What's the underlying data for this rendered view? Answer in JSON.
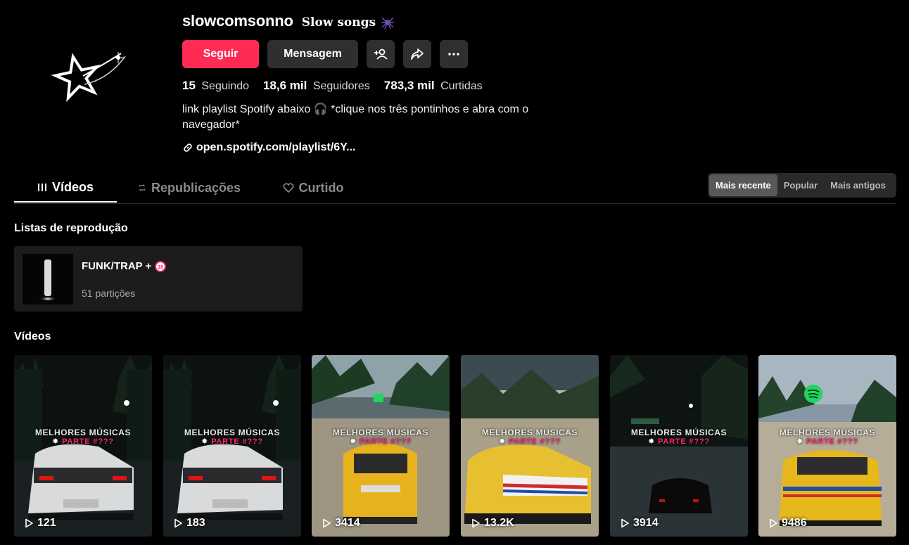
{
  "profile": {
    "username": "slowcomsonno",
    "nickname": "Slow songs",
    "follow_label": "Seguir",
    "message_label": "Mensagem",
    "stats": [
      {
        "value": "15",
        "label": "Seguindo"
      },
      {
        "value": "18,6 mil",
        "label": "Seguidores"
      },
      {
        "value": "783,3 mil",
        "label": "Curtidas"
      }
    ],
    "bio_line1": "link playlist Spotify abaixo 🎧 *clique nos três pontinhos e abra com o",
    "bio_line2": "navegador*",
    "link": "open.spotify.com/playlist/6Y..."
  },
  "tabs": [
    {
      "label": "Vídeos",
      "icon": "bars-icon",
      "active": true
    },
    {
      "label": "Republicações",
      "icon": "repost-icon",
      "active": false
    },
    {
      "label": "Curtido",
      "icon": "heart-icon",
      "active": false
    }
  ],
  "sort": {
    "options": [
      "Mais recente",
      "Popular",
      "Mais antigos"
    ],
    "selected": "Mais recente"
  },
  "playlists_section": {
    "title": "Listas de reprodução",
    "items": [
      {
        "name": "FUNK/TRAP +",
        "badge": "18+ age badge icon",
        "count": "51 partições"
      }
    ]
  },
  "videos_section": {
    "title": "Vídeos",
    "items": [
      {
        "views": "121",
        "caption1": "MELHORES MÚSICAS",
        "caption2": "PARTE #???",
        "scene": "night"
      },
      {
        "views": "183",
        "caption1": "MELHORES MÚSICAS",
        "caption2": "PARTE #???",
        "scene": "night"
      },
      {
        "views": "3414",
        "caption1": "MELHORES MÚSICAS",
        "caption2": "PARTE #???",
        "scene": "rally"
      },
      {
        "views": "13.2K",
        "caption1": "MELHORES MÚSICAS",
        "caption2": "PARTE #???",
        "scene": "rally2"
      },
      {
        "views": "3914",
        "caption1": "MELHORES MÚSICAS",
        "caption2": "PARTE #???",
        "scene": "dark"
      },
      {
        "views": "9486",
        "caption1": "MELHORES MÚSICAS",
        "caption2": "PARTE #???",
        "scene": "rally3"
      }
    ]
  },
  "colors": {
    "accent": "#fe2c55",
    "button_bg": "#2f2f2f",
    "caption_pink": "#ff2a7a"
  }
}
